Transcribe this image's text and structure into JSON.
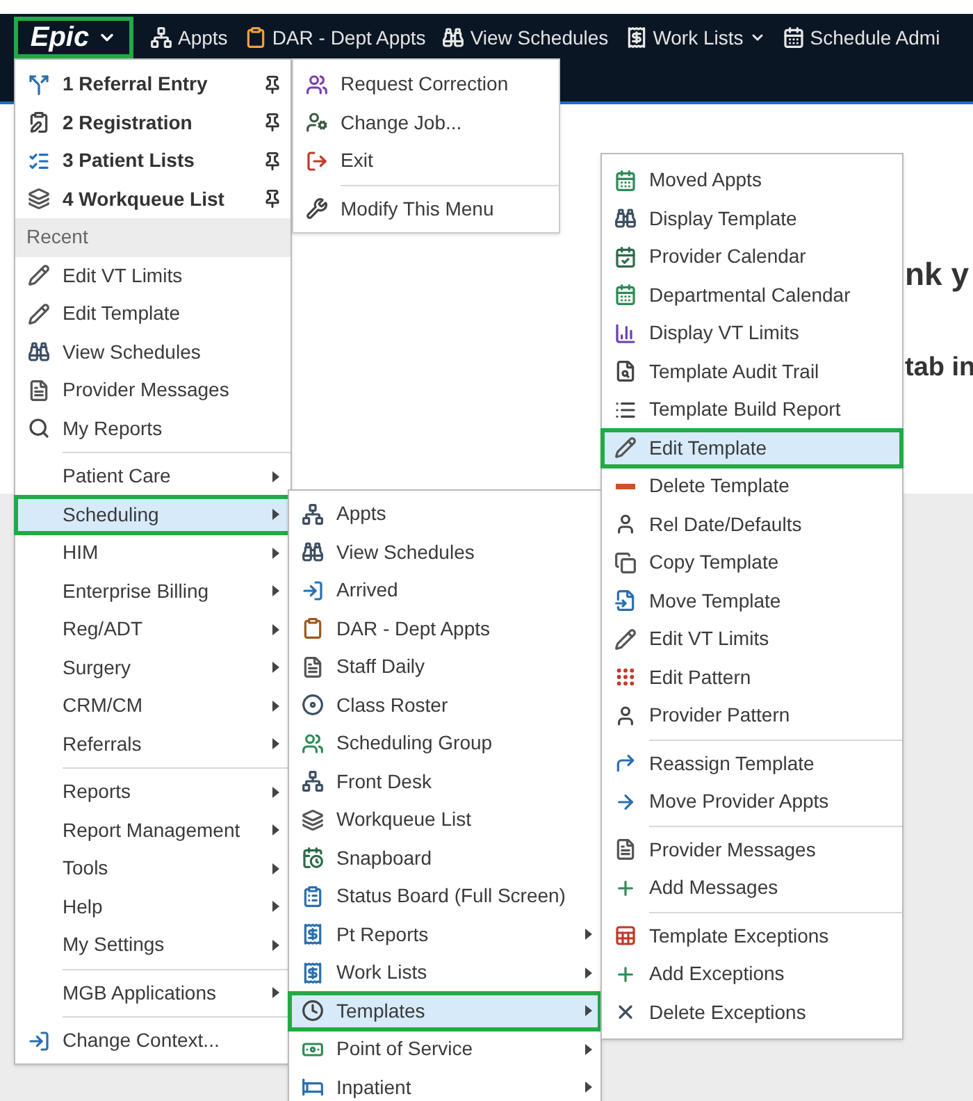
{
  "top_bar": {
    "epic_button": {
      "label": "Epic",
      "selected": true
    },
    "items": [
      {
        "label": "Appts",
        "has_menu": false
      },
      {
        "label": "DAR - Dept Appts",
        "has_menu": false
      },
      {
        "label": "View Schedules",
        "has_menu": false
      },
      {
        "label": "Work Lists",
        "has_menu": true
      },
      {
        "label": "Schedule Admi",
        "has_menu": false
      }
    ]
  },
  "page_text": [
    "nk y",
    "tab in"
  ],
  "epic_menu": {
    "groups": [
      {
        "items": [
          {
            "kind": "pinned",
            "label": "1 Referral Entry",
            "selected": false
          },
          {
            "kind": "pinned",
            "label": "2 Registration",
            "selected": false
          },
          {
            "kind": "pinned",
            "label": "3 Patient Lists",
            "selected": false
          },
          {
            "kind": "pinned",
            "label": "4 Workqueue List",
            "selected": false
          },
          {
            "kind": "header",
            "label": "Recent"
          },
          {
            "kind": "item",
            "label": "Edit VT Limits",
            "selected": false
          },
          {
            "kind": "item",
            "label": "Edit Template",
            "selected": false
          },
          {
            "kind": "item",
            "label": "View Schedules",
            "selected": false
          },
          {
            "kind": "item",
            "label": "Provider Messages",
            "selected": false
          },
          {
            "kind": "item",
            "label": "My Reports",
            "selected": false
          }
        ]
      },
      {
        "items": [
          {
            "kind": "submenu",
            "label": "Patient Care",
            "selected": false
          },
          {
            "kind": "submenu",
            "label": "Scheduling",
            "selected": true
          },
          {
            "kind": "submenu",
            "label": "HIM",
            "selected": false
          },
          {
            "kind": "submenu",
            "label": "Enterprise Billing",
            "selected": false
          },
          {
            "kind": "submenu",
            "label": "Reg/ADT",
            "selected": false
          },
          {
            "kind": "submenu",
            "label": "Surgery",
            "selected": false
          },
          {
            "kind": "submenu",
            "label": "CRM/CM",
            "selected": false
          },
          {
            "kind": "submenu",
            "label": "Referrals",
            "selected": false
          }
        ]
      },
      {
        "items": [
          {
            "kind": "submenu",
            "label": "Reports",
            "selected": false
          },
          {
            "kind": "submenu",
            "label": "Report Management",
            "selected": false
          },
          {
            "kind": "submenu",
            "label": "Tools",
            "selected": false
          },
          {
            "kind": "submenu",
            "label": "Help",
            "selected": false
          },
          {
            "kind": "submenu",
            "label": "My Settings",
            "selected": false
          }
        ]
      },
      {
        "items": [
          {
            "kind": "submenu",
            "label": "MGB Applications",
            "selected": false
          }
        ]
      },
      {
        "items": [
          {
            "kind": "item",
            "label": "Change Context...",
            "selected": false
          }
        ]
      }
    ]
  },
  "epic_menu_side": {
    "groups": [
      {
        "items": [
          {
            "kind": "item",
            "label": "Request Correction",
            "selected": false
          },
          {
            "kind": "item",
            "label": "Change Job...",
            "selected": false
          },
          {
            "kind": "item",
            "label": "Exit",
            "selected": false
          }
        ]
      },
      {
        "items": [
          {
            "kind": "item",
            "label": "Modify This Menu",
            "selected": false
          }
        ]
      }
    ]
  },
  "scheduling_menu": {
    "groups": [
      {
        "items": [
          {
            "kind": "item",
            "label": "Appts",
            "selected": false
          },
          {
            "kind": "item",
            "label": "View Schedules",
            "selected": false
          },
          {
            "kind": "item",
            "label": "Arrived",
            "selected": false
          },
          {
            "kind": "item",
            "label": "DAR - Dept Appts",
            "selected": false
          },
          {
            "kind": "item",
            "label": "Staff Daily",
            "selected": false
          },
          {
            "kind": "item",
            "label": "Class Roster",
            "selected": false
          },
          {
            "kind": "item",
            "label": "Scheduling Group",
            "selected": false
          },
          {
            "kind": "item",
            "label": "Front Desk",
            "selected": false
          },
          {
            "kind": "item",
            "label": "Workqueue List",
            "selected": false
          },
          {
            "kind": "item",
            "label": "Snapboard",
            "selected": false
          },
          {
            "kind": "item",
            "label": "Status Board (Full Screen)",
            "selected": false
          },
          {
            "kind": "submenu",
            "label": "Pt Reports",
            "selected": false
          },
          {
            "kind": "submenu",
            "label": "Work Lists",
            "selected": false
          },
          {
            "kind": "submenu",
            "label": "Templates",
            "selected": true
          },
          {
            "kind": "submenu",
            "label": "Point of Service",
            "selected": false
          },
          {
            "kind": "submenu",
            "label": "Inpatient",
            "selected": false
          }
        ]
      }
    ]
  },
  "templates_menu": {
    "groups": [
      {
        "items": [
          {
            "kind": "item",
            "label": "Moved Appts",
            "selected": false
          },
          {
            "kind": "item",
            "label": "Display Template",
            "selected": false
          },
          {
            "kind": "item",
            "label": "Provider Calendar",
            "selected": false
          },
          {
            "kind": "item",
            "label": "Departmental Calendar",
            "selected": false
          },
          {
            "kind": "item",
            "label": "Display VT Limits",
            "selected": false
          },
          {
            "kind": "item",
            "label": "Template Audit Trail",
            "selected": false
          },
          {
            "kind": "item",
            "label": "Template Build Report",
            "selected": false
          },
          {
            "kind": "item",
            "label": "Edit Template",
            "selected": true
          },
          {
            "kind": "item",
            "label": "Delete Template",
            "selected": false
          },
          {
            "kind": "item",
            "label": "Rel Date/Defaults",
            "selected": false
          },
          {
            "kind": "item",
            "label": "Copy Template",
            "selected": false
          },
          {
            "kind": "item",
            "label": "Move Template",
            "selected": false
          },
          {
            "kind": "item",
            "label": "Edit VT Limits",
            "selected": false
          },
          {
            "kind": "item",
            "label": "Edit Pattern",
            "selected": false
          },
          {
            "kind": "item",
            "label": "Provider Pattern",
            "selected": false
          }
        ]
      },
      {
        "items": [
          {
            "kind": "item",
            "label": "Reassign Template",
            "selected": false
          },
          {
            "kind": "item",
            "label": "Move Provider Appts",
            "selected": false
          }
        ]
      },
      {
        "items": [
          {
            "kind": "item",
            "label": "Provider Messages",
            "selected": false
          },
          {
            "kind": "item",
            "label": "Add Messages",
            "selected": false
          }
        ]
      },
      {
        "items": [
          {
            "kind": "item",
            "label": "Template Exceptions",
            "selected": false
          },
          {
            "kind": "item",
            "label": "Add Exceptions",
            "selected": false
          },
          {
            "kind": "item",
            "label": "Delete Exceptions",
            "selected": false
          }
        ]
      }
    ]
  }
}
